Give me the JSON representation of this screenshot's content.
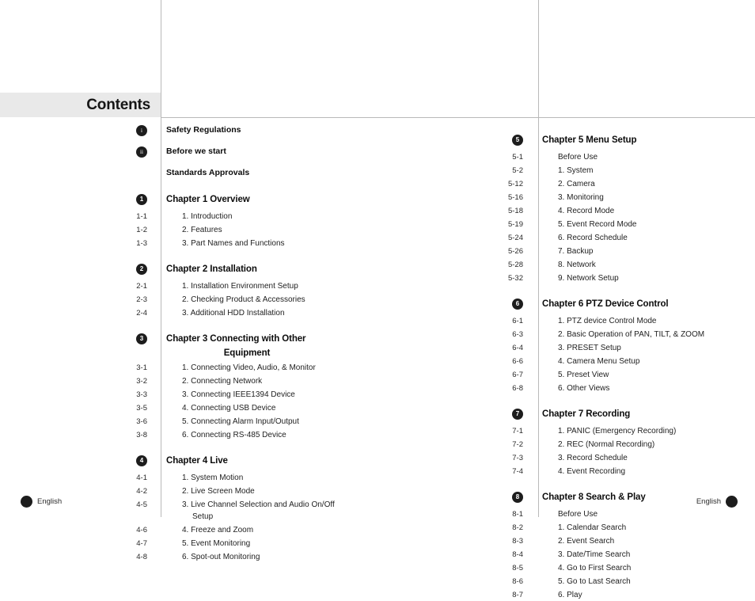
{
  "page": {
    "header_title": "Contents",
    "band_color": "#e9e9e9",
    "rule_color": "#b9b9b9",
    "bullet_color": "#1d1d1d"
  },
  "footer": {
    "left_label": "English",
    "right_label": "English"
  },
  "columns": {
    "left": [
      {
        "type": "front",
        "marker": "i",
        "marker_style": "roman",
        "label": "Safety Regulations"
      },
      {
        "type": "front",
        "marker": "ii",
        "marker_style": "roman",
        "label": "Before we start"
      },
      {
        "type": "front",
        "marker": "",
        "marker_style": "none",
        "label": "Standards Approvals"
      },
      {
        "type": "chapter",
        "marker": "1",
        "marker_style": "number",
        "label": "Chapter 1 Overview",
        "label_line2": ""
      },
      {
        "type": "section",
        "page": "1-1",
        "label": "1. Introduction"
      },
      {
        "type": "section",
        "page": "1-2",
        "label": "2. Features"
      },
      {
        "type": "section",
        "page": "1-3",
        "label": "3. Part Names and Functions"
      },
      {
        "type": "chapter",
        "marker": "2",
        "marker_style": "number",
        "label": "Chapter 2 Installation",
        "label_line2": ""
      },
      {
        "type": "section",
        "page": "2-1",
        "label": "1. Installation Environment Setup"
      },
      {
        "type": "section",
        "page": "2-3",
        "label": "2. Checking Product & Accessories"
      },
      {
        "type": "section",
        "page": "2-4",
        "label": "3. Additional HDD Installation"
      },
      {
        "type": "chapter",
        "marker": "3",
        "marker_style": "number",
        "label": "Chapter 3 Connecting with Other",
        "label_line2": "Equipment"
      },
      {
        "type": "section",
        "page": "3-1",
        "label": "1. Connecting Video, Audio, & Monitor"
      },
      {
        "type": "section",
        "page": "3-2",
        "label": "2. Connecting Network"
      },
      {
        "type": "section",
        "page": "3-3",
        "label": "3. Connecting IEEE1394 Device"
      },
      {
        "type": "section",
        "page": "3-5",
        "label": "4. Connecting USB Device"
      },
      {
        "type": "section",
        "page": "3-6",
        "label": "5. Connecting Alarm Input/Output"
      },
      {
        "type": "section",
        "page": "3-8",
        "label": "6. Connecting RS-485 Device"
      },
      {
        "type": "chapter",
        "marker": "4",
        "marker_style": "number",
        "label": "Chapter 4 Live",
        "label_line2": ""
      },
      {
        "type": "section",
        "page": "4-1",
        "label": "1. System Motion"
      },
      {
        "type": "section",
        "page": "4-2",
        "label": "2. Live Screen Mode"
      },
      {
        "type": "section",
        "page": "4-5",
        "label": "3. Live Channel Selection and Audio On/Off",
        "label_line2": "Setup"
      },
      {
        "type": "section",
        "page": "4-6",
        "label": "4. Freeze and Zoom"
      },
      {
        "type": "section",
        "page": "4-7",
        "label": "5. Event Monitoring"
      },
      {
        "type": "section",
        "page": "4-8",
        "label": "6. Spot-out Monitoring"
      }
    ],
    "right": [
      {
        "type": "chapter",
        "marker": "5",
        "marker_style": "number",
        "label": "Chapter 5 Menu Setup",
        "label_line2": ""
      },
      {
        "type": "section",
        "page": "5-1",
        "label": "Before Use"
      },
      {
        "type": "section",
        "page": "5-2",
        "label": "1. System"
      },
      {
        "type": "section",
        "page": "5-12",
        "label": "2. Camera"
      },
      {
        "type": "section",
        "page": "5-16",
        "label": "3. Monitoring"
      },
      {
        "type": "section",
        "page": "5-18",
        "label": "4. Record Mode"
      },
      {
        "type": "section",
        "page": "5-19",
        "label": "5. Event Record Mode"
      },
      {
        "type": "section",
        "page": "5-24",
        "label": "6. Record Schedule"
      },
      {
        "type": "section",
        "page": "5-26",
        "label": "7. Backup"
      },
      {
        "type": "section",
        "page": "5-28",
        "label": "8. Network"
      },
      {
        "type": "section",
        "page": "5-32",
        "label": "9. Network Setup"
      },
      {
        "type": "chapter",
        "marker": "6",
        "marker_style": "number",
        "label": "Chapter 6 PTZ Device Control",
        "label_line2": ""
      },
      {
        "type": "section",
        "page": "6-1",
        "label": "1. PTZ device Control Mode"
      },
      {
        "type": "section",
        "page": "6-3",
        "label": "2. Basic Operation of PAN, TILT, & ZOOM"
      },
      {
        "type": "section",
        "page": "6-4",
        "label": "3. PRESET Setup"
      },
      {
        "type": "section",
        "page": "6-6",
        "label": "4. Camera Menu Setup"
      },
      {
        "type": "section",
        "page": "6-7",
        "label": "5. Preset View"
      },
      {
        "type": "section",
        "page": "6-8",
        "label": "6. Other Views"
      },
      {
        "type": "chapter",
        "marker": "7",
        "marker_style": "number",
        "label": "Chapter 7 Recording",
        "label_line2": ""
      },
      {
        "type": "section",
        "page": "7-1",
        "label": "1. PANIC (Emergency Recording)"
      },
      {
        "type": "section",
        "page": "7-2",
        "label": "2. REC (Normal Recording)"
      },
      {
        "type": "section",
        "page": "7-3",
        "label": "3. Record Schedule"
      },
      {
        "type": "section",
        "page": "7-4",
        "label": "4. Event Recording"
      },
      {
        "type": "chapter",
        "marker": "8",
        "marker_style": "number",
        "label": "Chapter 8 Search & Play",
        "label_line2": ""
      },
      {
        "type": "section",
        "page": "8-1",
        "label": "Before Use"
      },
      {
        "type": "section",
        "page": "8-2",
        "label": "1. Calendar Search"
      },
      {
        "type": "section",
        "page": "8-3",
        "label": "2. Event Search"
      },
      {
        "type": "section",
        "page": "8-4",
        "label": "3. Date/Time Search"
      },
      {
        "type": "section",
        "page": "8-5",
        "label": "4. Go to First Search"
      },
      {
        "type": "section",
        "page": "8-6",
        "label": "5. Go to Last Search"
      },
      {
        "type": "section",
        "page": "8-7",
        "label": "6. Play"
      }
    ]
  }
}
